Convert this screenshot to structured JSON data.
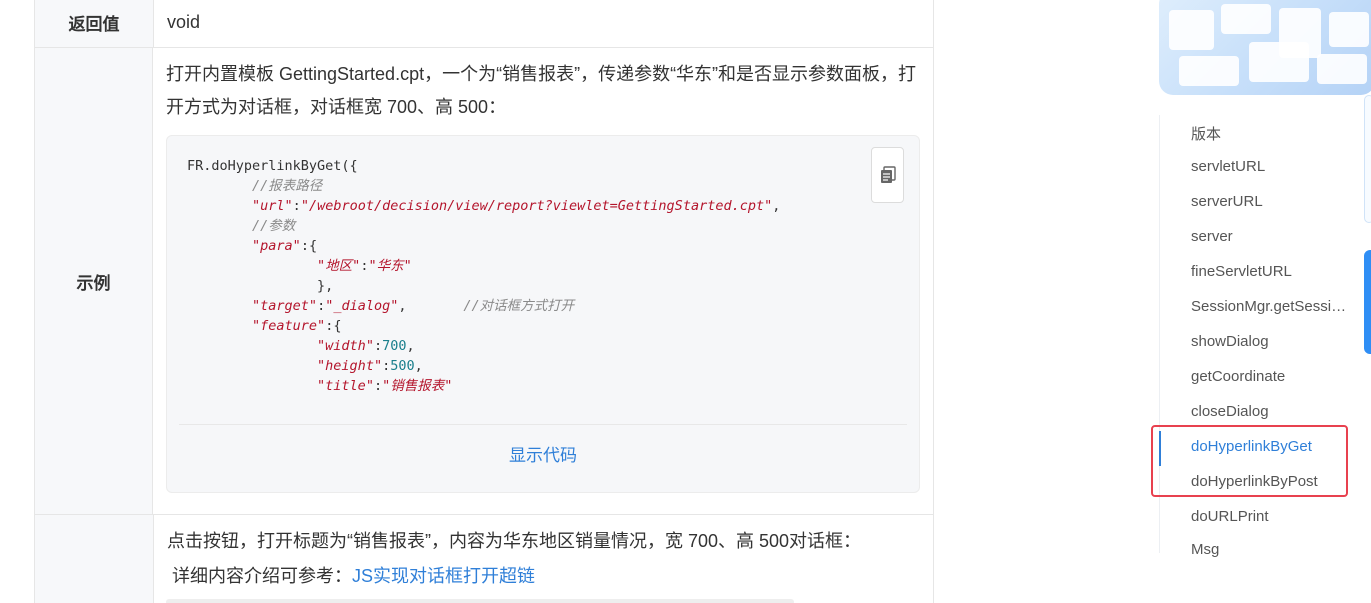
{
  "table": {
    "return_label": "返回值",
    "return_value": "void",
    "example_label": "示例",
    "example_desc": "打开内置模板 GettingStarted.cpt，一个为“销售报表”，传递参数“华东”和是否显示参数面板，打开方式为对话框，对话框宽 700、高 500：",
    "show_code": "显示代码",
    "next_desc": "点击按钮，打开标题为“销售报表”，内容为华东地区销量情况，宽 700、高 500对话框：",
    "ref_prefix": "详细内容介绍可参考：",
    "ref_link": "JS实现对话框打开超链"
  },
  "code": {
    "l1": "FR.doHyperlinkByGet({",
    "l2_cmt": "//报表路径",
    "l3_key": "\"url\"",
    "l3_val": "\"/webroot/decision/view/report?viewlet=GettingStarted.cpt\"",
    "l4_cmt": "//参数",
    "l5_key": "\"para\"",
    "l6_key": "\"地区\"",
    "l6_val": "\"华东\"",
    "l7": "},",
    "l8_key": "\"target\"",
    "l8_val": "\"_dialog\"",
    "l8_cmt": "//对话框方式打开",
    "l9_key": "\"feature\"",
    "l10_key": "\"width\"",
    "l10_val": "700",
    "l11_key": "\"height\"",
    "l11_val": "500",
    "l12_key": "\"title\"",
    "l12_val": "\"销售报表\""
  },
  "toc": {
    "items": [
      "版本",
      "servletURL",
      "serverURL",
      "server",
      "fineServletURL",
      "SessionMgr.getSessi…",
      "showDialog",
      "getCoordinate",
      "closeDialog",
      "doHyperlinkByGet",
      "doHyperlinkByPost",
      "doURLPrint",
      "Msg"
    ],
    "active": "doHyperlinkByGet"
  },
  "colors": {
    "accent": "#2f7fd8",
    "highlight": "#e8414f",
    "string": "#b4152c",
    "number": "#1a7f8c"
  },
  "icons": {
    "copy": "copy-icon"
  }
}
